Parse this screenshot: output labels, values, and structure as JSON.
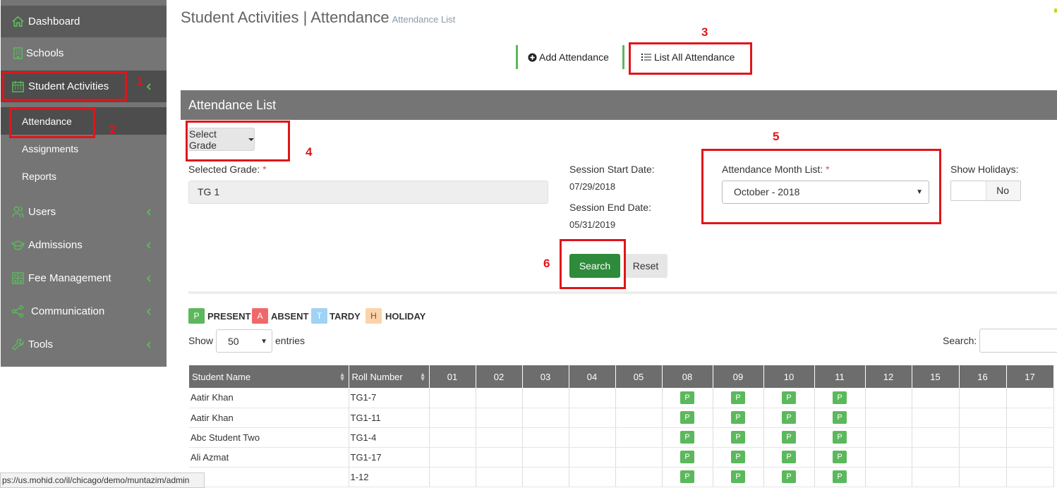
{
  "sidebar": {
    "items": [
      {
        "label": "Dashboard",
        "icon": "home-icon"
      },
      {
        "label": "Schools",
        "icon": "building-icon"
      },
      {
        "label": "Student Activities",
        "icon": "calendar-icon"
      },
      {
        "label": "Users",
        "icon": "users-icon"
      },
      {
        "label": "Admissions",
        "icon": "graduation-cap-icon"
      },
      {
        "label": "Fee Management",
        "icon": "calculator-icon"
      },
      {
        "label": "Communication",
        "icon": "share-icon"
      },
      {
        "label": "Tools",
        "icon": "wrench-icon"
      }
    ],
    "subitems": [
      {
        "label": "Attendance"
      },
      {
        "label": "Assignments"
      },
      {
        "label": "Reports"
      }
    ],
    "accent": "#5cb85c"
  },
  "header": {
    "title": "Student Activities | Attendance",
    "subtitle": "Attendance List"
  },
  "tabs": {
    "add": "Add Attendance",
    "list": "List All Attendance"
  },
  "panel": {
    "title": "Attendance List",
    "select_grade": "Select Grade",
    "selected_grade_label": "Selected Grade:",
    "selected_grade_value": "TG 1",
    "session_start_label": "Session Start Date:",
    "session_start_value": "07/29/2018",
    "session_end_label": "Session End Date:",
    "session_end_value": "05/31/2019",
    "month_list_label": "Attendance Month List:",
    "month_list_value": "October - 2018",
    "show_holidays_label": "Show Holidays:",
    "show_holidays_value": "No",
    "required_mark": "*",
    "search_button": "Search",
    "reset_button": "Reset"
  },
  "legend": [
    {
      "letter": "P",
      "label": "PRESENT",
      "color": "#5cb85c"
    },
    {
      "letter": "A",
      "label": "ABSENT",
      "color": "#f0686a"
    },
    {
      "letter": "T",
      "label": "TARDY",
      "color": "#9fd2f5"
    },
    {
      "letter": "H",
      "label": "HOLIDAY",
      "color": "#fbd3a8"
    }
  ],
  "table_controls": {
    "show_label": "Show",
    "entries_value": "50",
    "entries_label": "entries",
    "search_label": "Search:"
  },
  "table": {
    "columns": [
      "Student Name",
      "Roll Number",
      "01",
      "02",
      "03",
      "04",
      "05",
      "08",
      "09",
      "10",
      "11",
      "12",
      "15",
      "16",
      "17"
    ],
    "rows": [
      {
        "name": "Aatir Khan",
        "roll": "TG1-7",
        "marks": [
          "",
          "",
          "",
          "",
          "",
          "P",
          "P",
          "P",
          "P",
          "",
          "",
          "",
          ""
        ]
      },
      {
        "name": "Aatir Khan",
        "roll": "TG1-11",
        "marks": [
          "",
          "",
          "",
          "",
          "",
          "P",
          "P",
          "P",
          "P",
          "",
          "",
          "",
          ""
        ]
      },
      {
        "name": "Abc Student Two",
        "roll": "TG1-4",
        "marks": [
          "",
          "",
          "",
          "",
          "",
          "P",
          "P",
          "P",
          "P",
          "",
          "",
          "",
          ""
        ]
      },
      {
        "name": "Ali Azmat",
        "roll": "TG1-17",
        "marks": [
          "",
          "",
          "",
          "",
          "",
          "P",
          "P",
          "P",
          "P",
          "",
          "",
          "",
          ""
        ]
      },
      {
        "name": "",
        "roll": "1-12",
        "marks": [
          "",
          "",
          "",
          "",
          "",
          "P",
          "P",
          "P",
          "P",
          "",
          "",
          "",
          ""
        ]
      }
    ]
  },
  "annotations": [
    "1",
    "2",
    "3",
    "4",
    "5",
    "6"
  ],
  "status_url": "ps://us.mohid.co/il/chicago/demo/muntazim/admin"
}
